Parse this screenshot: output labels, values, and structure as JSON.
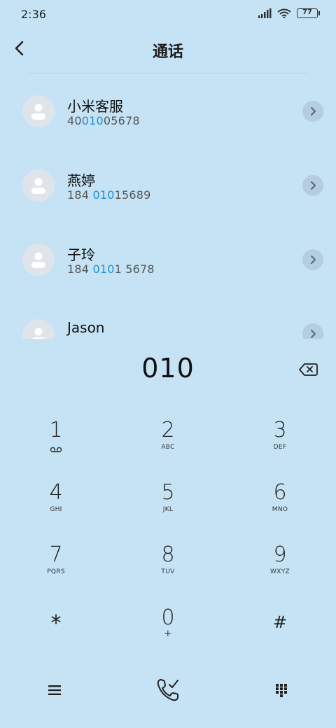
{
  "status": {
    "time": "2:36",
    "battery": "77"
  },
  "header": {
    "title": "通话"
  },
  "contacts": [
    {
      "name": "小米客服",
      "number_pre": "40",
      "number_hl": "010",
      "number_post": "05678"
    },
    {
      "name": "燕婷",
      "number_pre": "184 ",
      "number_hl": "010",
      "number_post": "15689"
    },
    {
      "name": "子玲",
      "number_pre": "184 ",
      "number_hl": "010",
      "number_post": "1 5678"
    },
    {
      "name": "Jason",
      "number_pre": "",
      "number_hl": "",
      "number_post": ""
    }
  ],
  "dialer": {
    "entry": "010",
    "keys": [
      {
        "digit": "1",
        "letters": ""
      },
      {
        "digit": "2",
        "letters": "ABC"
      },
      {
        "digit": "3",
        "letters": "DEF"
      },
      {
        "digit": "4",
        "letters": "GHI"
      },
      {
        "digit": "5",
        "letters": "JKL"
      },
      {
        "digit": "6",
        "letters": "MNO"
      },
      {
        "digit": "7",
        "letters": "PQRS"
      },
      {
        "digit": "8",
        "letters": "TUV"
      },
      {
        "digit": "9",
        "letters": "WXYZ"
      },
      {
        "digit": "*",
        "letters": ""
      },
      {
        "digit": "0",
        "letters": "+"
      },
      {
        "digit": "#",
        "letters": ""
      }
    ]
  },
  "icons": {
    "back": "back-arrow-icon",
    "chevron": "chevron-right-icon",
    "backspace": "backspace-icon",
    "voicemail": "voicemail-icon",
    "menu": "menu-icon",
    "call": "phone-call-icon",
    "keypad": "keypad-icon"
  },
  "colors": {
    "background": "#c5e3f5",
    "highlight": "#1b8fe0"
  }
}
